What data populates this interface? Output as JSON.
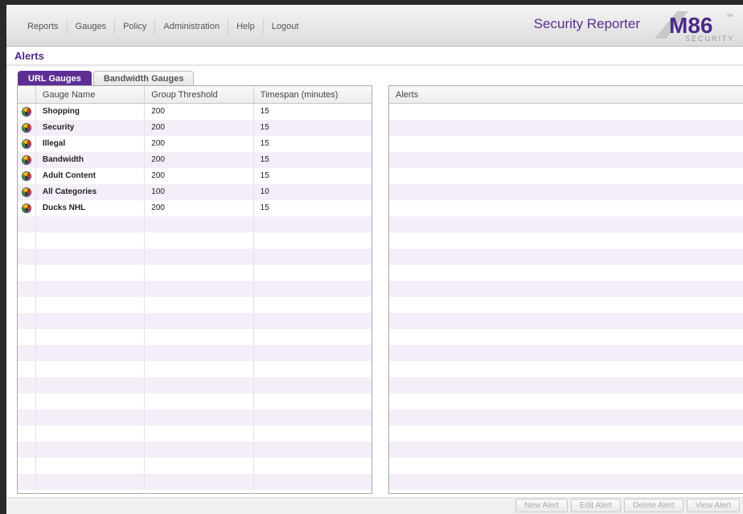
{
  "menu": [
    "Reports",
    "Gauges",
    "Policy",
    "Administration",
    "Help",
    "Logout"
  ],
  "app_title": "Security Reporter",
  "logo": {
    "text": "M86",
    "subtext": "SECURITY",
    "tm": "TM"
  },
  "page_title": "Alerts",
  "tabs": [
    {
      "label": "URL Gauges",
      "active": true
    },
    {
      "label": "Bandwidth Gauges",
      "active": false
    }
  ],
  "gauges_table": {
    "columns": [
      "Gauge Name",
      "Group Threshold",
      "Timespan (minutes)"
    ],
    "rows": [
      {
        "name": "Shopping",
        "threshold": "200",
        "timespan": "15"
      },
      {
        "name": "Security",
        "threshold": "200",
        "timespan": "15"
      },
      {
        "name": "Illegal",
        "threshold": "200",
        "timespan": "15"
      },
      {
        "name": "Bandwidth",
        "threshold": "200",
        "timespan": "15"
      },
      {
        "name": "Adult Content",
        "threshold": "200",
        "timespan": "15"
      },
      {
        "name": "All Categories",
        "threshold": "100",
        "timespan": "10"
      },
      {
        "name": "Ducks NHL",
        "threshold": "200",
        "timespan": "15"
      }
    ]
  },
  "alerts_table": {
    "columns": [
      "Alerts"
    ],
    "rows": []
  },
  "buttons": {
    "new_alert": "New Alert",
    "edit_alert": "Edit Alert",
    "delete_alert": "Delete Alert",
    "view_alert": "View Alert"
  },
  "colors": {
    "accent": "#5d2f95",
    "row_alt": "#f3eef8"
  }
}
